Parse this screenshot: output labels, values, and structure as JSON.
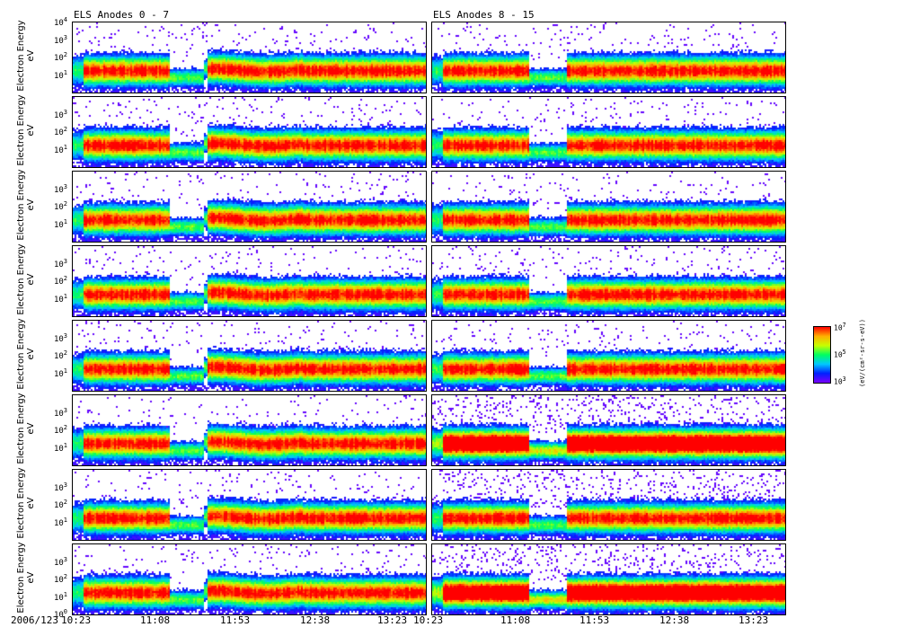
{
  "chart_data": {
    "type": "heatmap",
    "columns": [
      {
        "title": "ELS Anodes 0 - 7"
      },
      {
        "title": "ELS Anodes 8 - 15"
      }
    ],
    "rows": 8,
    "ylabel": "Electron Energy",
    "yunit": "eV",
    "yscale": "log",
    "ylim": [
      1,
      10000
    ],
    "ytick_labels": [
      [
        "10",
        "4"
      ],
      [
        "10",
        "3"
      ],
      [
        "10",
        "2"
      ],
      [
        "10",
        "1"
      ],
      [
        "10",
        "0"
      ]
    ],
    "date_label": "2006/123",
    "xtick_labels": [
      "10:23",
      "11:08",
      "11:53",
      "12:38",
      "13:23"
    ],
    "colorbar": {
      "label": "(eV/(cm²-sr-s-eV))",
      "ticks": [
        [
          "10",
          "7"
        ],
        [
          "10",
          "5"
        ],
        [
          "10",
          "3"
        ]
      ],
      "colormap": [
        "#7a00ff",
        "#0020ff",
        "#00c8ff",
        "#00ff60",
        "#c8ff00",
        "#ffb000",
        "#ff0000"
      ]
    }
  }
}
